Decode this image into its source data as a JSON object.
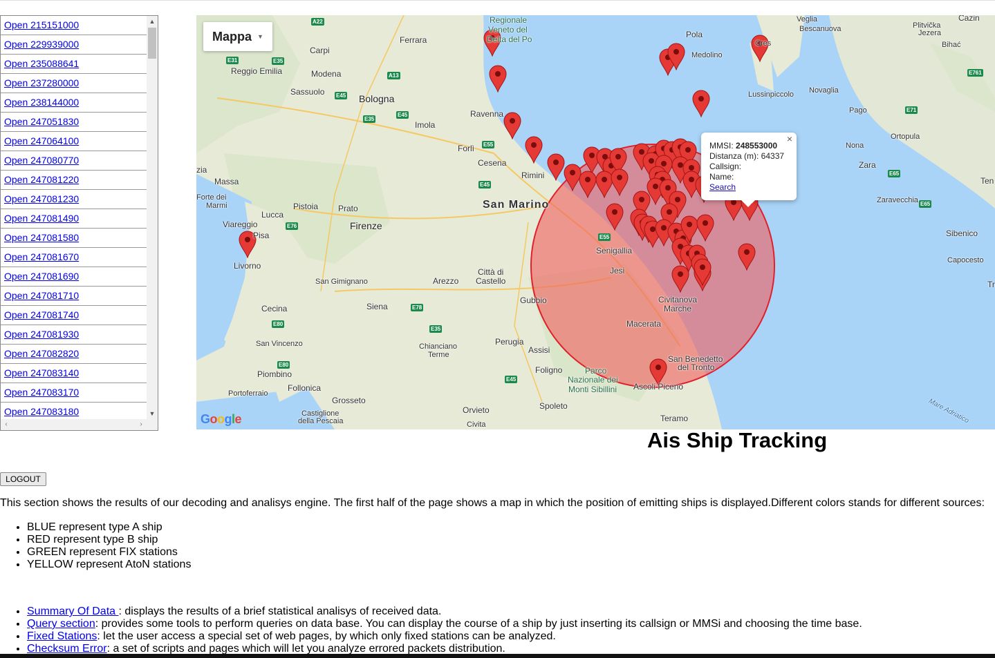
{
  "ship_list": {
    "items": [
      {
        "label": "Open 215151000"
      },
      {
        "label": "Open 229939000"
      },
      {
        "label": "Open 235088641"
      },
      {
        "label": "Open 237280000"
      },
      {
        "label": "Open 238144000"
      },
      {
        "label": "Open 247051830"
      },
      {
        "label": "Open 247064100"
      },
      {
        "label": "Open 247080770"
      },
      {
        "label": "Open 247081220"
      },
      {
        "label": "Open 247081230"
      },
      {
        "label": "Open 247081490"
      },
      {
        "label": "Open 247081580"
      },
      {
        "label": "Open 247081670"
      },
      {
        "label": "Open 247081690"
      },
      {
        "label": "Open 247081710"
      },
      {
        "label": "Open 247081740"
      },
      {
        "label": "Open 247081930"
      },
      {
        "label": "Open 247082820"
      },
      {
        "label": "Open 247083140"
      },
      {
        "label": "Open 247083170"
      },
      {
        "label": "Open 247083180"
      }
    ]
  },
  "map": {
    "type_button": "Mappa",
    "brand": "Google",
    "circle_color": "#f25d5d",
    "marker_color": "#e53935",
    "places": {
      "regionale": "Regionale",
      "veneto": "Veneto del",
      "delta": "Delta del Po",
      "ferrara": "Ferrara",
      "carpi": "Carpi",
      "reggio": "Reggio Emilia",
      "modena": "Modena",
      "sassuolo": "Sassuolo",
      "bologna": "Bologna",
      "imola": "Imola",
      "ravenna": "Ravenna",
      "forli": "Forlì",
      "cesena": "Cesena",
      "rimini": "Rimini",
      "sanmarino": "San Marino",
      "massa": "Massa",
      "fortedei": "Forte dei",
      "marmi": "Marmi",
      "lucca": "Lucca",
      "pistoia": "Pistoia",
      "prato": "Prato",
      "firenze": "Firenze",
      "viareggio": "Viareggio",
      "pisa": "Pisa",
      "livorno": "Livorno",
      "sangimignano": "San Gimignano",
      "arezzo": "Arezzo",
      "cittadi": "Città di",
      "castello": "Castello",
      "cecina": "Cecina",
      "siena": "Siena",
      "gubbio": "Gubbio",
      "senigallia": "Senigallia",
      "jesi": "Jesi",
      "civitanova": "Civitanova",
      "marche": "Marche",
      "macerata": "Macerata",
      "sanvincenzo": "San Vincenzo",
      "chianciano": "Chianciano",
      "terme": "Terme",
      "perugia": "Perugia",
      "assisi": "Assisi",
      "foligno": "Foligno",
      "parco": "Parco",
      "nazionale": "Nazionale dei",
      "sibillini": "Monti Sibillini",
      "ascoli": "Ascoli Piceno",
      "sanbenedetto": "San Benedetto",
      "deltronto": "del Tronto",
      "piombino": "Piombino",
      "follonica": "Follonica",
      "portoferraio": "Portoferraio",
      "grosseto": "Grosseto",
      "castiglione": "Castiglione",
      "pescaia": "della Pescaia",
      "orvieto": "Orvieto",
      "spoleto": "Spoleto",
      "teramo": "Teramo",
      "civita": "Civita",
      "pola": "Pola",
      "medolino": "Medolino",
      "cres": "Cres",
      "lussinpiccolo": "Lussinpiccolo",
      "novaglia": "Novaglia",
      "pago": "Pago",
      "ortopula": "Ortopula",
      "nona": "Nona",
      "zara": "Zara",
      "zaravecchia": "Zaravecchia",
      "sibenico": "Sibenico",
      "capocesto": "Capocesto",
      "cazin": "Cazin",
      "plitvicka": "Plitvička",
      "jezera": "Jezera",
      "bihac": "Bihać",
      "veglia": "Veglia",
      "bescanuova": "Bescanuova",
      "mareadriatico": "Mare Adriatico",
      "zia": "zia",
      "ten": "Ten",
      "tr": "Tr"
    },
    "roads": {
      "a22": "A22",
      "e31": "E31",
      "e35a": "E35",
      "a13": "A13",
      "e45a": "E45",
      "e35b": "E35",
      "e45b": "E45",
      "e55a": "E55",
      "e45c": "E45",
      "e76": "E76",
      "e55b": "E55",
      "e78": "E78",
      "e80a": "E80",
      "e80b": "E80",
      "e35c": "E35",
      "e45d": "E45",
      "e761": "E761",
      "e71": "E71",
      "e65a": "E65",
      "e65b": "E65"
    },
    "infowindow": {
      "mmsi_label": "MMSI:",
      "mmsi_value": "248553000",
      "distance": "Distanza (m): 64337",
      "callsign": "Callsign:",
      "name": "Name:",
      "search": "Search",
      "close": "×"
    }
  },
  "page": {
    "title": "Ais Ship Tracking",
    "logout": "LOGOUT",
    "description": "This section shows the results of our decoding and analisys engine. The first half of the page shows a map in which the position of emitting ships is displayed.Different colors stands for different sources:",
    "legend": [
      "BLUE represent type A ship",
      "RED represent type B ship",
      "GREEN represent FIX stations",
      "YELLOW represent AtoN stations"
    ],
    "sections": [
      {
        "link": "Summary Of Data ",
        "text": ": displays the results of a brief statistical analisys of received data."
      },
      {
        "link": "Query section",
        "text": ": provides some tools to perform queries on data base. You can display the course of a ship by just inserting its callsign or MMSi and choosing the time base."
      },
      {
        "link": "Fixed Stations",
        "text": ": let the user access a special set of web pages, by which only fixed stations can be analyzed."
      },
      {
        "link": "Checksum Error",
        "text": ": a set of scripts and pages which will let you analyze errored packets distribution."
      }
    ]
  }
}
